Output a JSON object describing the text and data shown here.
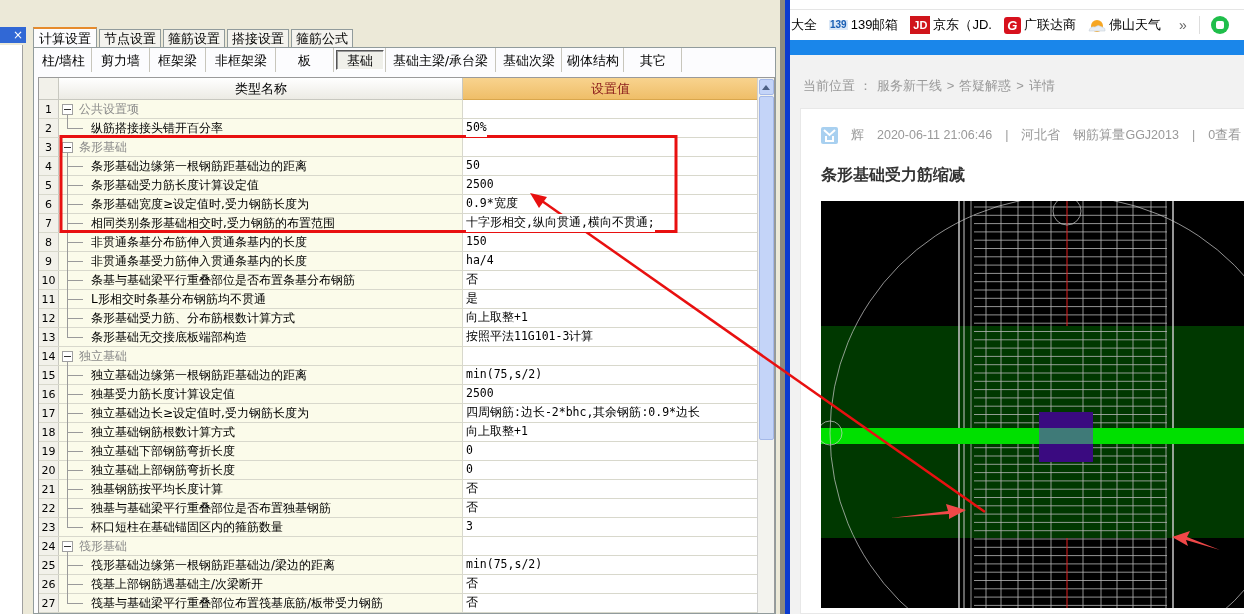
{
  "side_panel": {
    "close": "×"
  },
  "tabs": [
    {
      "label": "计算设置",
      "selected": true
    },
    {
      "label": "节点设置",
      "selected": false
    },
    {
      "label": "箍筋设置",
      "selected": false
    },
    {
      "label": "搭接设置",
      "selected": false
    },
    {
      "label": "箍筋公式",
      "selected": false
    }
  ],
  "subtabs": [
    {
      "label": "柱/墙柱",
      "selected": false
    },
    {
      "label": "剪力墙",
      "selected": false
    },
    {
      "label": "框架梁",
      "selected": false
    },
    {
      "label": "非框架梁",
      "selected": false
    },
    {
      "label": "板",
      "selected": false
    },
    {
      "label": "基础",
      "selected": true
    },
    {
      "label": "基础主梁/承台梁",
      "selected": false
    },
    {
      "label": "基础次梁",
      "selected": false
    },
    {
      "label": "砌体结构",
      "selected": false
    },
    {
      "label": "其它",
      "selected": false
    }
  ],
  "table": {
    "columns": [
      "类型名称",
      "设置值"
    ],
    "groups": [
      {
        "num": "1",
        "name": "公共设置项",
        "expanded": true,
        "children": [
          {
            "num": "2",
            "name": "纵筋搭接接头错开百分率",
            "value": "50%"
          }
        ]
      },
      {
        "num": "3",
        "name": "条形基础",
        "expanded": true,
        "children": [
          {
            "num": "4",
            "name": "条形基础边缘第一根钢筋距基础边的距离",
            "value": "50"
          },
          {
            "num": "5",
            "name": "条形基础受力筋长度计算设定值",
            "value": "2500"
          },
          {
            "num": "6",
            "name": "条形基础宽度≥设定值时,受力钢筋长度为",
            "value": "0.9*宽度"
          },
          {
            "num": "7",
            "name": "相同类别条形基础相交时,受力钢筋的布置范围",
            "value": "十字形相交,纵向贯通,横向不贯通;"
          },
          {
            "num": "8",
            "name": "非贯通条基分布筋伸入贯通条基内的长度",
            "value": "150"
          },
          {
            "num": "9",
            "name": "非贯通条基受力筋伸入贯通条基内的长度",
            "value": "ha/4"
          },
          {
            "num": "10",
            "name": "条基与基础梁平行重叠部位是否布置条基分布钢筋",
            "value": "否"
          },
          {
            "num": "11",
            "name": "L形相交时条基分布钢筋均不贯通",
            "value": "是"
          },
          {
            "num": "12",
            "name": "条形基础受力筋、分布筋根数计算方式",
            "value": "向上取整+1"
          },
          {
            "num": "13",
            "name": "条形基础无交接底板端部构造",
            "value": "按照平法11G101-3计算"
          }
        ]
      },
      {
        "num": "14",
        "name": "独立基础",
        "expanded": true,
        "children": [
          {
            "num": "15",
            "name": "独立基础边缘第一根钢筋距基础边的距离",
            "value": "min(75,s/2)"
          },
          {
            "num": "16",
            "name": "独基受力筋长度计算设定值",
            "value": "2500"
          },
          {
            "num": "17",
            "name": "独立基础边长≥设定值时,受力钢筋长度为",
            "value": "四周钢筋:边长-2*bhc,其余钢筋:0.9*边长"
          },
          {
            "num": "18",
            "name": "独立基础钢筋根数计算方式",
            "value": "向上取整+1"
          },
          {
            "num": "19",
            "name": "独立基础下部钢筋弯折长度",
            "value": "0"
          },
          {
            "num": "20",
            "name": "独立基础上部钢筋弯折长度",
            "value": "0"
          },
          {
            "num": "21",
            "name": "独基钢筋按平均长度计算",
            "value": "否"
          },
          {
            "num": "22",
            "name": "独基与基础梁平行重叠部位是否布置独基钢筋",
            "value": "否"
          },
          {
            "num": "23",
            "name": "杯口短柱在基础锚固区内的箍筋数量",
            "value": "3"
          }
        ]
      },
      {
        "num": "24",
        "name": "筏形基础",
        "expanded": true,
        "children": [
          {
            "num": "25",
            "name": "筏形基础边缘第一根钢筋距基础边/梁边的距离",
            "value": "min(75,s/2)"
          },
          {
            "num": "26",
            "name": "筏基上部钢筋遇基础主/次梁断开",
            "value": "否"
          },
          {
            "num": "27",
            "name": "筏基与基础梁平行重叠部位布置筏基底筋/板带受力钢筋",
            "value": "否"
          }
        ]
      }
    ]
  },
  "browser": {
    "bookmarks": [
      {
        "kind": "plain",
        "label": "大全"
      },
      {
        "kind": "badge-139",
        "icon_text": "139",
        "label": "139邮箱"
      },
      {
        "kind": "jd",
        "icon_text": "JD",
        "label": "京东（JD."
      },
      {
        "kind": "g",
        "icon_text": "G",
        "label": "广联达商"
      },
      {
        "kind": "weather",
        "label": "佛山天气"
      }
    ],
    "more": "»",
    "breadcrumb": [
      "当前位置 ：",
      "服务新干线",
      ">",
      "答疑解惑",
      ">",
      "详情"
    ],
    "meta": [
      "辉",
      "2020-06-11 21:06:46",
      "|",
      "河北省",
      "钢筋算量GGJ2013",
      "|",
      "0查看"
    ],
    "title": "条形基础受力筋缩减"
  }
}
